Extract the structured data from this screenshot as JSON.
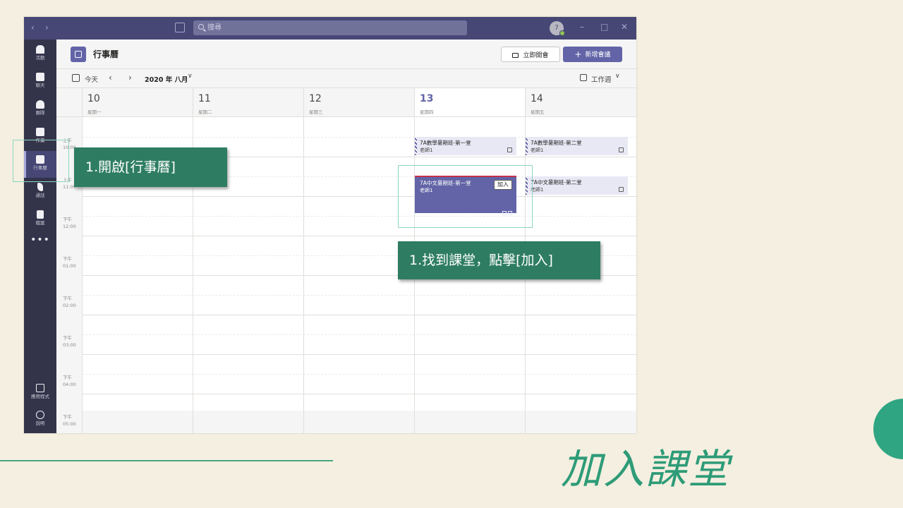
{
  "window": {
    "search_placeholder": "搜尋",
    "avatar_initial": "7",
    "nav_back": "‹",
    "nav_forward": "›",
    "win_minimize": "–",
    "win_maximize": "□",
    "win_close": "✕"
  },
  "rail": {
    "items": [
      {
        "label": "活動",
        "icon": "bell-icon"
      },
      {
        "label": "聊天",
        "icon": "chat-icon"
      },
      {
        "label": "團隊",
        "icon": "teams-icon"
      },
      {
        "label": "作業",
        "icon": "assignments-icon"
      },
      {
        "label": "行事曆",
        "icon": "calendar-icon"
      },
      {
        "label": "通話",
        "icon": "phone-icon"
      },
      {
        "label": "檔案",
        "icon": "files-icon"
      }
    ],
    "more": "•••",
    "apps_label": "應用程式",
    "help_label": "說明"
  },
  "header": {
    "title": "行事曆",
    "meet_now": "立即開會",
    "new_meeting": "新增會議"
  },
  "toolbar": {
    "today": "今天",
    "month": "2020 年 八月",
    "view": "工作週"
  },
  "days": [
    {
      "num": "10",
      "name": "星期一"
    },
    {
      "num": "11",
      "name": "星期二"
    },
    {
      "num": "12",
      "name": "星期三"
    },
    {
      "num": "13",
      "name": "星期四",
      "today": true
    },
    {
      "num": "14",
      "name": "星期五"
    }
  ],
  "times": [
    {
      "p": "上午",
      "t": "10:00"
    },
    {
      "p": "上午",
      "t": "11:00"
    },
    {
      "p": "下午",
      "t": "12:00"
    },
    {
      "p": "下午",
      "t": "01:00"
    },
    {
      "p": "下午",
      "t": "02:00"
    },
    {
      "p": "下午",
      "t": "03:00"
    },
    {
      "p": "下午",
      "t": "04:00"
    },
    {
      "p": "下午",
      "t": "05:00"
    }
  ],
  "events": {
    "thu_math": {
      "title": "7A數學暑期班-第一堂",
      "sub": "老師1"
    },
    "fri_math": {
      "title": "7A數學暑期班-第二堂",
      "sub": "老師1"
    },
    "thu_chinese": {
      "title": "7A中文暑期班-第一堂",
      "sub": "老師1",
      "join": "加入"
    },
    "fri_chinese": {
      "title": "7A中文暑期班-第二堂",
      "sub": "老師1"
    }
  },
  "annotations": {
    "step_open_calendar": "1.開啟[行事曆]",
    "step_join": "1.找到課堂，點擊[加入]"
  },
  "slide": {
    "title": "加入課堂"
  },
  "colors": {
    "teams_purple": "#6264a7",
    "callout_green": "#2e7d62",
    "slide_bg": "#f4efe0",
    "accent_teal": "#2fa582"
  }
}
